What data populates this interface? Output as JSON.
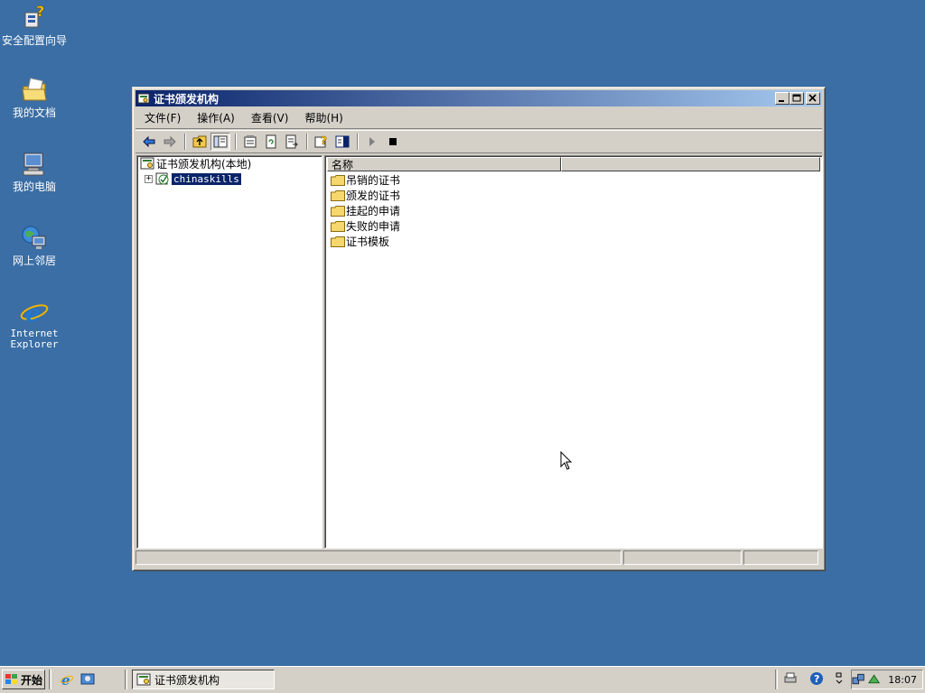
{
  "desktop": {
    "icons": [
      {
        "label": "安全配置向导"
      },
      {
        "label": "我的文档"
      },
      {
        "label": "我的电脑"
      },
      {
        "label": "网上邻居"
      },
      {
        "label_line1": "Internet",
        "label_line2": "Explorer"
      }
    ]
  },
  "window": {
    "title": "证书颁发机构",
    "menu": [
      "文件(F)",
      "操作(A)",
      "查看(V)",
      "帮助(H)"
    ],
    "tree": {
      "root": "证书颁发机构(本地)",
      "child": "chinaskills"
    },
    "list": {
      "column_header": "名称",
      "items": [
        "吊销的证书",
        "颁发的证书",
        "挂起的申请",
        "失败的申请",
        "证书模板"
      ]
    }
  },
  "taskbar": {
    "start_label": "开始",
    "task_button": "证书颁发机构",
    "clock": "18:07"
  },
  "colors": {
    "desktop": "#3a6ea5",
    "titlebar_start": "#0a246a",
    "titlebar_end": "#a6caf0",
    "folder": "#f5d76e"
  }
}
